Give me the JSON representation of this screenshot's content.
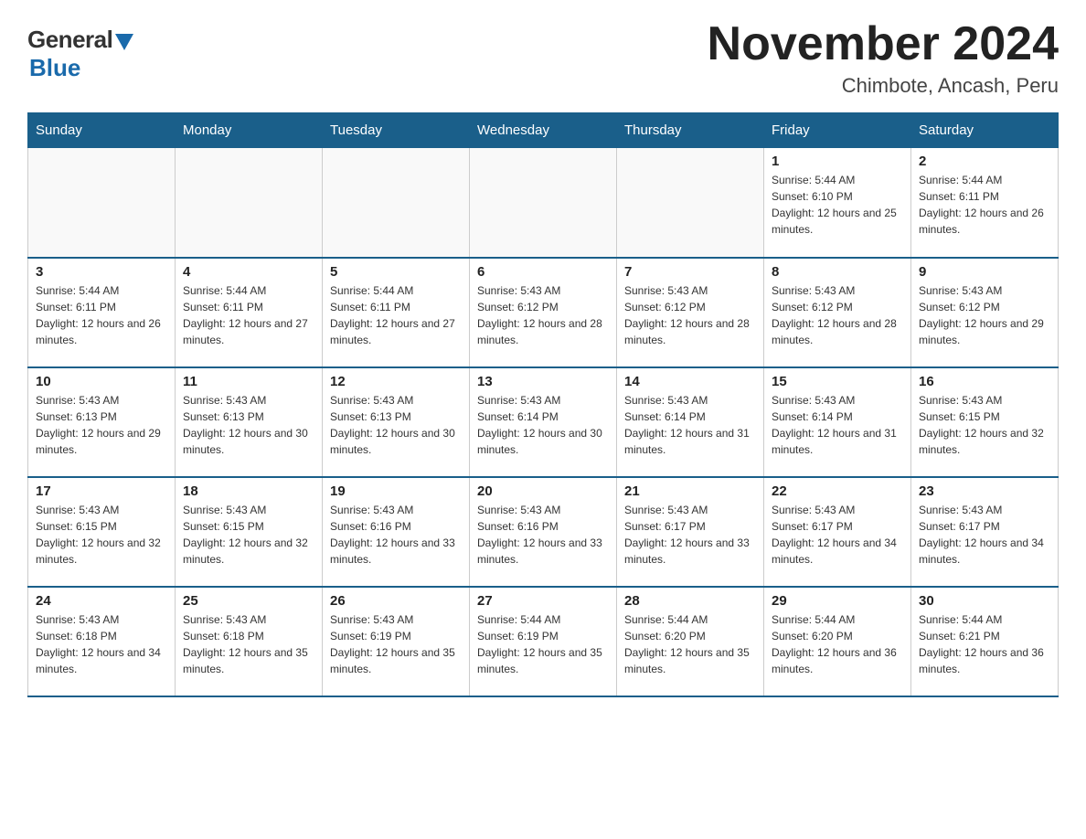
{
  "logo": {
    "general": "General",
    "blue": "Blue"
  },
  "header": {
    "title": "November 2024",
    "location": "Chimbote, Ancash, Peru"
  },
  "days_of_week": [
    "Sunday",
    "Monday",
    "Tuesday",
    "Wednesday",
    "Thursday",
    "Friday",
    "Saturday"
  ],
  "weeks": [
    [
      {
        "day": "",
        "info": ""
      },
      {
        "day": "",
        "info": ""
      },
      {
        "day": "",
        "info": ""
      },
      {
        "day": "",
        "info": ""
      },
      {
        "day": "",
        "info": ""
      },
      {
        "day": "1",
        "info": "Sunrise: 5:44 AM\nSunset: 6:10 PM\nDaylight: 12 hours and 25 minutes."
      },
      {
        "day": "2",
        "info": "Sunrise: 5:44 AM\nSunset: 6:11 PM\nDaylight: 12 hours and 26 minutes."
      }
    ],
    [
      {
        "day": "3",
        "info": "Sunrise: 5:44 AM\nSunset: 6:11 PM\nDaylight: 12 hours and 26 minutes."
      },
      {
        "day": "4",
        "info": "Sunrise: 5:44 AM\nSunset: 6:11 PM\nDaylight: 12 hours and 27 minutes."
      },
      {
        "day": "5",
        "info": "Sunrise: 5:44 AM\nSunset: 6:11 PM\nDaylight: 12 hours and 27 minutes."
      },
      {
        "day": "6",
        "info": "Sunrise: 5:43 AM\nSunset: 6:12 PM\nDaylight: 12 hours and 28 minutes."
      },
      {
        "day": "7",
        "info": "Sunrise: 5:43 AM\nSunset: 6:12 PM\nDaylight: 12 hours and 28 minutes."
      },
      {
        "day": "8",
        "info": "Sunrise: 5:43 AM\nSunset: 6:12 PM\nDaylight: 12 hours and 28 minutes."
      },
      {
        "day": "9",
        "info": "Sunrise: 5:43 AM\nSunset: 6:12 PM\nDaylight: 12 hours and 29 minutes."
      }
    ],
    [
      {
        "day": "10",
        "info": "Sunrise: 5:43 AM\nSunset: 6:13 PM\nDaylight: 12 hours and 29 minutes."
      },
      {
        "day": "11",
        "info": "Sunrise: 5:43 AM\nSunset: 6:13 PM\nDaylight: 12 hours and 30 minutes."
      },
      {
        "day": "12",
        "info": "Sunrise: 5:43 AM\nSunset: 6:13 PM\nDaylight: 12 hours and 30 minutes."
      },
      {
        "day": "13",
        "info": "Sunrise: 5:43 AM\nSunset: 6:14 PM\nDaylight: 12 hours and 30 minutes."
      },
      {
        "day": "14",
        "info": "Sunrise: 5:43 AM\nSunset: 6:14 PM\nDaylight: 12 hours and 31 minutes."
      },
      {
        "day": "15",
        "info": "Sunrise: 5:43 AM\nSunset: 6:14 PM\nDaylight: 12 hours and 31 minutes."
      },
      {
        "day": "16",
        "info": "Sunrise: 5:43 AM\nSunset: 6:15 PM\nDaylight: 12 hours and 32 minutes."
      }
    ],
    [
      {
        "day": "17",
        "info": "Sunrise: 5:43 AM\nSunset: 6:15 PM\nDaylight: 12 hours and 32 minutes."
      },
      {
        "day": "18",
        "info": "Sunrise: 5:43 AM\nSunset: 6:15 PM\nDaylight: 12 hours and 32 minutes."
      },
      {
        "day": "19",
        "info": "Sunrise: 5:43 AM\nSunset: 6:16 PM\nDaylight: 12 hours and 33 minutes."
      },
      {
        "day": "20",
        "info": "Sunrise: 5:43 AM\nSunset: 6:16 PM\nDaylight: 12 hours and 33 minutes."
      },
      {
        "day": "21",
        "info": "Sunrise: 5:43 AM\nSunset: 6:17 PM\nDaylight: 12 hours and 33 minutes."
      },
      {
        "day": "22",
        "info": "Sunrise: 5:43 AM\nSunset: 6:17 PM\nDaylight: 12 hours and 34 minutes."
      },
      {
        "day": "23",
        "info": "Sunrise: 5:43 AM\nSunset: 6:17 PM\nDaylight: 12 hours and 34 minutes."
      }
    ],
    [
      {
        "day": "24",
        "info": "Sunrise: 5:43 AM\nSunset: 6:18 PM\nDaylight: 12 hours and 34 minutes."
      },
      {
        "day": "25",
        "info": "Sunrise: 5:43 AM\nSunset: 6:18 PM\nDaylight: 12 hours and 35 minutes."
      },
      {
        "day": "26",
        "info": "Sunrise: 5:43 AM\nSunset: 6:19 PM\nDaylight: 12 hours and 35 minutes."
      },
      {
        "day": "27",
        "info": "Sunrise: 5:44 AM\nSunset: 6:19 PM\nDaylight: 12 hours and 35 minutes."
      },
      {
        "day": "28",
        "info": "Sunrise: 5:44 AM\nSunset: 6:20 PM\nDaylight: 12 hours and 35 minutes."
      },
      {
        "day": "29",
        "info": "Sunrise: 5:44 AM\nSunset: 6:20 PM\nDaylight: 12 hours and 36 minutes."
      },
      {
        "day": "30",
        "info": "Sunrise: 5:44 AM\nSunset: 6:21 PM\nDaylight: 12 hours and 36 minutes."
      }
    ]
  ]
}
